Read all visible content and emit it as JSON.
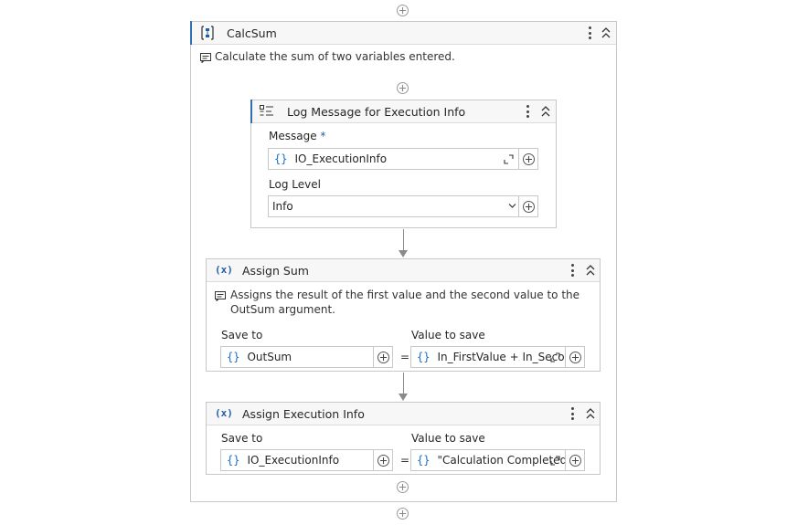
{
  "sequence": {
    "title": "CalcSum",
    "icon": "sequence-icon",
    "annotation": "Calculate the sum of two variables entered."
  },
  "log_message": {
    "title": "Log Message for Execution Info",
    "icon": "log-message-icon",
    "message_label": "Message",
    "required_mark": "*",
    "message_value": "IO_ExecutionInfo",
    "level_label": "Log Level",
    "level_value": "Info"
  },
  "assign_sum": {
    "title": "Assign Sum",
    "icon": "assign-icon",
    "icon_text": "(x)",
    "annotation": "Assigns the result of the first value and the second value to the OutSum argument.",
    "save_to_label": "Save to",
    "save_to_value": "OutSum",
    "value_label": "Value to save",
    "value_value": "In_FirstValue + In_SecondValue",
    "equals": "="
  },
  "assign_exec": {
    "title": "Assign Execution Info",
    "icon": "assign-icon",
    "icon_text": "(x)",
    "save_to_label": "Save to",
    "save_to_value": "IO_ExecutionInfo",
    "value_label": "Value to save",
    "value_value": "\"Calculation Completed\"",
    "equals": "="
  },
  "brace": "{}",
  "colors": {
    "accent": "#2f6fb4",
    "brace": "#1a6fc6",
    "border": "#c8c8c8"
  }
}
